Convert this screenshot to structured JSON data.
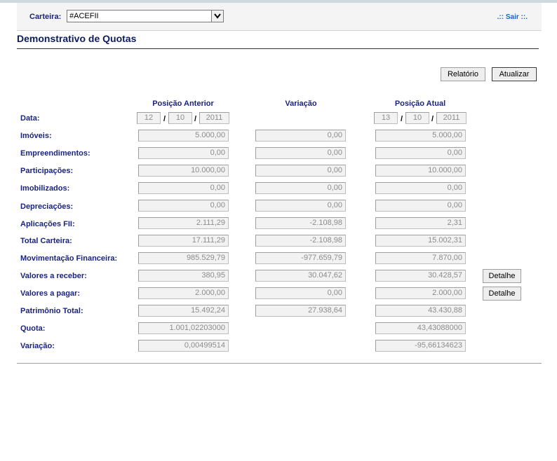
{
  "header": {
    "carteira_label": "Carteira:",
    "carteira_value": "#ACEFII",
    "sair_label": ".:: Sair ::."
  },
  "page_title": "Demonstrativo de Quotas",
  "buttons": {
    "relatorio": "Relatório",
    "atualizar": "Atualizar",
    "detalhe": "Detalhe"
  },
  "columns": {
    "anterior": "Posição Anterior",
    "variacao": "Variação",
    "atual": "Posição Atual"
  },
  "date_row": {
    "label": "Data:",
    "anterior": {
      "day": "12",
      "month": "10",
      "year": "2011"
    },
    "atual": {
      "day": "13",
      "month": "10",
      "year": "2011"
    },
    "separator": "/"
  },
  "rows": [
    {
      "label": "Imóveis:",
      "anterior": "5.000,00",
      "variacao": "0,00",
      "atual": "5.000,00"
    },
    {
      "label": "Empreendimentos:",
      "anterior": "0,00",
      "variacao": "0,00",
      "atual": "0,00"
    },
    {
      "label": "Participações:",
      "anterior": "10.000,00",
      "variacao": "0,00",
      "atual": "10.000,00"
    },
    {
      "label": "Imobilizados:",
      "anterior": "0,00",
      "variacao": "0,00",
      "atual": "0,00"
    },
    {
      "label": "Depreciações:",
      "anterior": "0,00",
      "variacao": "0,00",
      "atual": "0,00"
    },
    {
      "label": "Aplicações FII:",
      "anterior": "2.111,29",
      "variacao": "-2.108,98",
      "atual": "2,31"
    },
    {
      "label": "Total Carteira:",
      "anterior": "17.111,29",
      "variacao": "-2.108,98",
      "atual": "15.002,31"
    },
    {
      "label": "Movimentação Financeira:",
      "anterior": "985.529,79",
      "variacao": "-977.659,79",
      "atual": "7.870,00"
    },
    {
      "label": "Valores a receber:",
      "anterior": "380,95",
      "variacao": "30.047,62",
      "atual": "30.428,57"
    },
    {
      "label": "Valores a pagar:",
      "anterior": "2.000,00",
      "variacao": "0,00",
      "atual": "2.000,00"
    },
    {
      "label": "Patrimônio Total:",
      "anterior": "15.492,24",
      "variacao": "27.938,64",
      "atual": "43.430,88"
    }
  ],
  "quota_row": {
    "label": "Quota:",
    "anterior": "1.001,02203000",
    "atual": "43,43088000"
  },
  "variacao_row": {
    "label": "Variação:",
    "anterior": "0,00499514",
    "atual": "-95,66134623"
  }
}
